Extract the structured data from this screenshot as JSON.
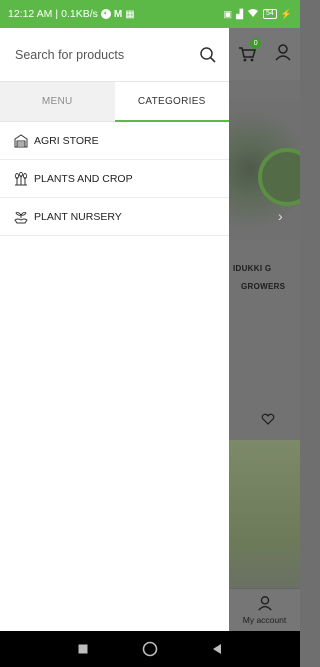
{
  "status_bar": {
    "time": "12:12 AM",
    "speed": "0.1KB/s",
    "battery": "54"
  },
  "drawer": {
    "search": {
      "placeholder": "Search for products"
    },
    "tabs": [
      {
        "label": "MENU",
        "active": false
      },
      {
        "label": "CATEGORIES",
        "active": true
      }
    ],
    "categories": [
      {
        "label": "AGRI STORE",
        "icon": "store-icon"
      },
      {
        "label": "PLANTS AND CROP",
        "icon": "plants-icon"
      },
      {
        "label": "PLANT NURSERY",
        "icon": "nursery-icon"
      }
    ]
  },
  "background_page": {
    "cart_count": "0",
    "banner_title_line1": "IDUKKI G",
    "banner_title_line2": "GROWERS",
    "bottom_nav_label": "My account"
  },
  "colors": {
    "accent": "#5cb947",
    "status_bar": "#5cb947",
    "overlay": "#6f6f6f"
  }
}
